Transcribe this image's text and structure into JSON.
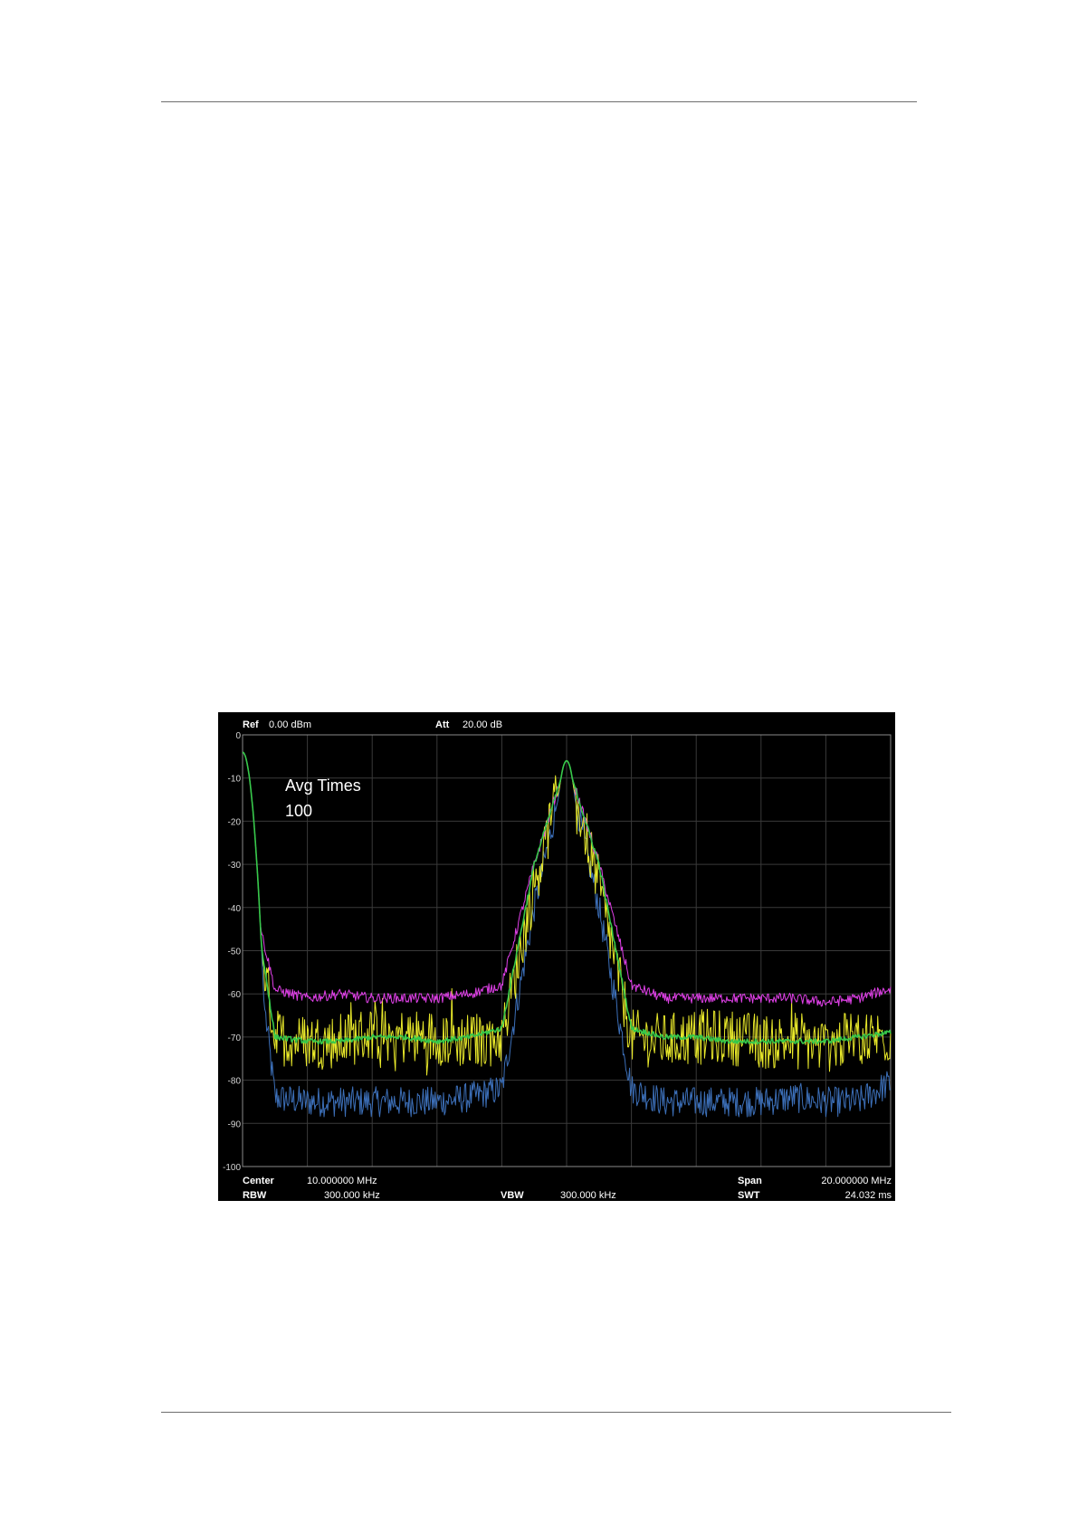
{
  "chart_data": {
    "type": "line",
    "header": {
      "ref_label": "Ref",
      "ref_value": "0.00 dBm",
      "att_label": "Att",
      "att_value": "20.00 dB"
    },
    "footer": {
      "center_label": "Center",
      "center_value": "10.000000 MHz",
      "span_label": "Span",
      "span_value": "20.000000 MHz",
      "rbw_label": "RBW",
      "rbw_value": "300.000 kHz",
      "vbw_label": "VBW",
      "vbw_value": "300.000 kHz",
      "swt_label": "SWT",
      "swt_value": "24.032 ms"
    },
    "annotation": [
      "Avg Times",
      "100"
    ],
    "y_ticks": [
      "0",
      "-10",
      "-20",
      "-30",
      "-40",
      "-50",
      "-60",
      "-70",
      "-80",
      "-90",
      "-100"
    ],
    "ylim": [
      -100,
      0
    ],
    "xlim_mhz": [
      0,
      20
    ],
    "grid": true,
    "series": [
      {
        "color": "#e040e8",
        "trace": "max hold",
        "x": [
          0,
          0.4,
          1.0,
          2.0,
          3.0,
          4.0,
          5.0,
          6.0,
          7.0,
          8.0,
          9.0,
          10.0,
          11.0,
          12.0,
          13.0,
          14.0,
          15.0,
          16.0,
          17.0,
          18.0,
          19.0,
          19.9
        ],
        "y": [
          -5,
          -40,
          -59,
          -61,
          -60,
          -61,
          -61,
          -61,
          -60,
          -58,
          -30,
          -6,
          -30,
          -58,
          -61,
          -61,
          -61,
          -61,
          -61,
          -62,
          -61,
          -59
        ]
      },
      {
        "color": "#e8e82a",
        "trace": "clear write",
        "x": [
          0,
          0.4,
          1.0,
          2.0,
          3.0,
          4.0,
          5.0,
          6.0,
          7.0,
          8.0,
          9.0,
          10.0,
          11.0,
          12.0,
          13.0,
          14.0,
          15.0,
          16.0,
          17.0,
          18.0,
          19.0,
          19.9
        ],
        "y": [
          -5,
          -40,
          -70,
          -71,
          -71,
          -69,
          -70,
          -70,
          -71,
          -70,
          -35,
          -6,
          -35,
          -70,
          -71,
          -70,
          -70,
          -71,
          -71,
          -72,
          -70,
          -70
        ]
      },
      {
        "color": "#36c84a",
        "trace": "average",
        "x": [
          0,
          0.4,
          1.0,
          2.0,
          3.0,
          4.0,
          5.0,
          6.0,
          7.0,
          8.0,
          9.0,
          10.0,
          11.0,
          12.0,
          13.0,
          14.0,
          15.0,
          16.0,
          17.0,
          18.0,
          19.0,
          19.9
        ],
        "y": [
          -5,
          -40,
          -70,
          -71,
          -71,
          -70,
          -70,
          -71,
          -70,
          -68,
          -30,
          -6,
          -30,
          -68,
          -70,
          -70,
          -71,
          -71,
          -71,
          -71,
          -70,
          -69
        ]
      },
      {
        "color": "#3c6fb8",
        "trace": "min hold",
        "x": [
          0,
          0.4,
          1.0,
          2.0,
          3.0,
          4.0,
          5.0,
          6.0,
          7.0,
          8.0,
          9.0,
          10.0,
          11.0,
          12.0,
          13.0,
          14.0,
          15.0,
          16.0,
          17.0,
          18.0,
          19.0,
          19.9
        ],
        "y": [
          -5,
          -45,
          -84,
          -85,
          -85,
          -85,
          -85,
          -85,
          -84,
          -82,
          -40,
          -6,
          -40,
          -82,
          -85,
          -85,
          -85,
          -85,
          -84,
          -85,
          -85,
          -81
        ]
      }
    ]
  }
}
